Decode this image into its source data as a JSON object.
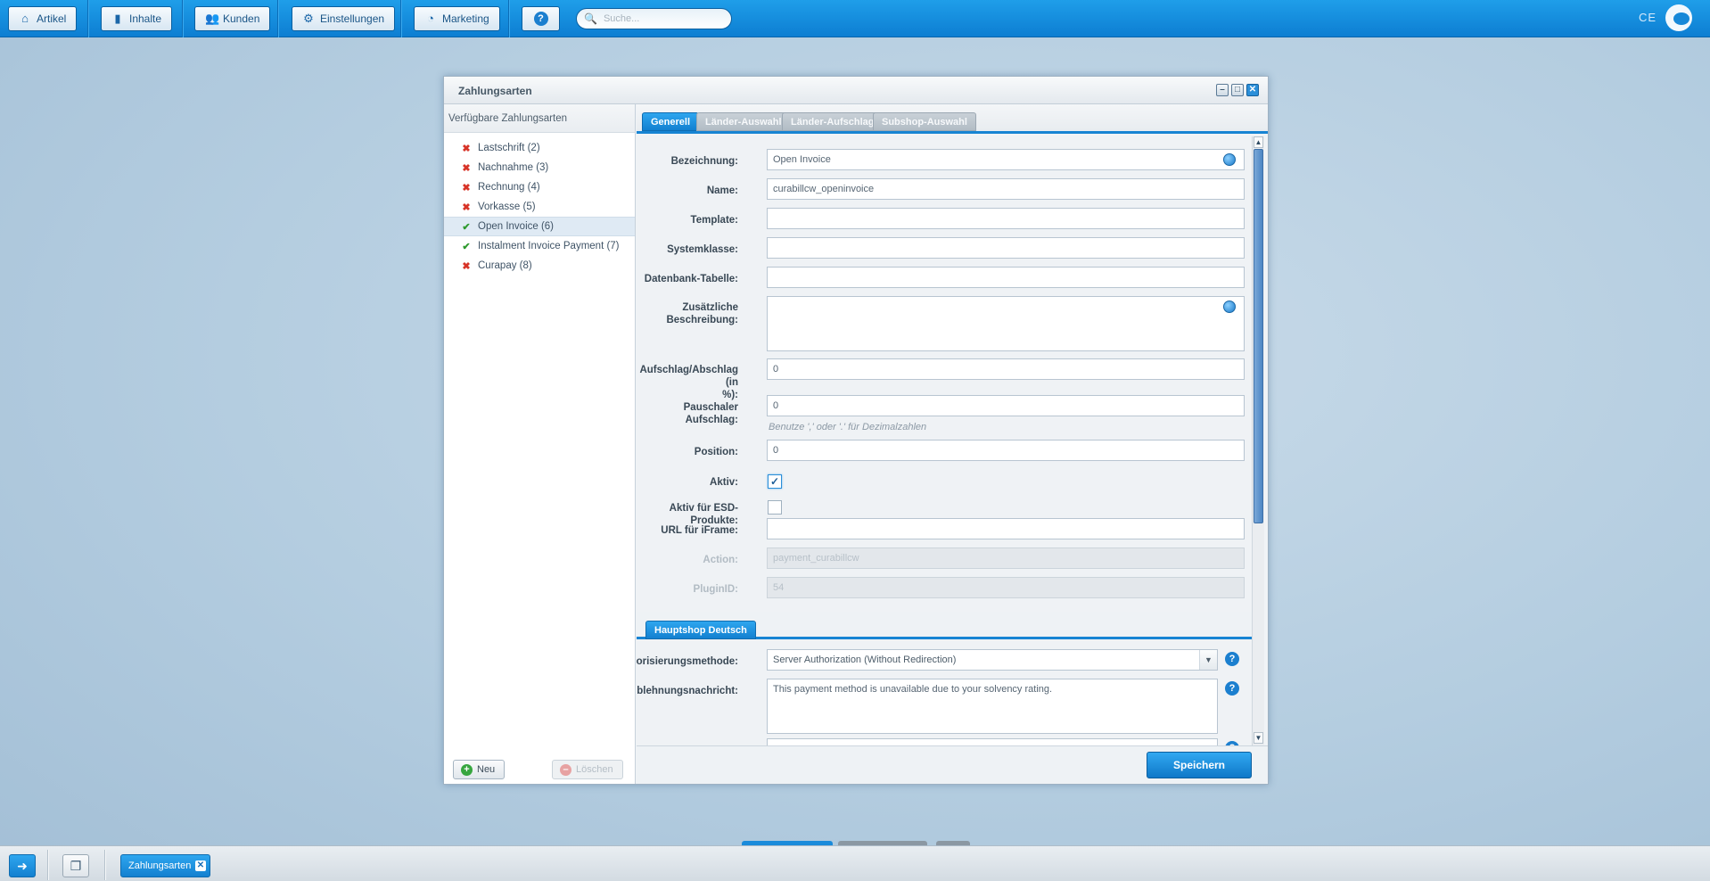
{
  "topbar": {
    "buttons": [
      {
        "label": "Artikel",
        "icon": "article-icon"
      },
      {
        "label": "Inhalte",
        "icon": "content-icon"
      },
      {
        "label": "Kunden",
        "icon": "customers-icon"
      },
      {
        "label": "Einstellungen",
        "icon": "gear-icon"
      },
      {
        "label": "Marketing",
        "icon": "chart-icon"
      }
    ],
    "help_label": "?",
    "search_placeholder": "Suche...",
    "right_text": "CE"
  },
  "window": {
    "title": "Zahlungsarten",
    "left_panel": {
      "header": "Verfügbare Zahlungsarten",
      "items": [
        {
          "label": "Lastschrift (2)",
          "active": false,
          "selected": false
        },
        {
          "label": "Nachnahme (3)",
          "active": false,
          "selected": false
        },
        {
          "label": "Rechnung (4)",
          "active": false,
          "selected": false
        },
        {
          "label": "Vorkasse (5)",
          "active": false,
          "selected": false
        },
        {
          "label": "Open Invoice (6)",
          "active": true,
          "selected": true
        },
        {
          "label": "Instalment Invoice Payment (7)",
          "active": true,
          "selected": false
        },
        {
          "label": "Curapay (8)",
          "active": false,
          "selected": false
        }
      ],
      "new_button": "Neu",
      "delete_button": "Löschen"
    },
    "tabs": [
      "Generell",
      "Länder-Auswahl",
      "Länder-Aufschlag",
      "Subshop-Auswahl"
    ],
    "active_tab": "Generell",
    "form": {
      "bezeichnung": {
        "label": "Bezeichnung:",
        "value": "Open Invoice"
      },
      "name": {
        "label": "Name:",
        "value": "curabillcw_openinvoice"
      },
      "template": {
        "label": "Template:",
        "value": ""
      },
      "systemklasse": {
        "label": "Systemklasse:",
        "value": ""
      },
      "datenbank": {
        "label": "Datenbank-Tabelle:",
        "value": ""
      },
      "beschreibung": {
        "label_line1": "Zusätzliche",
        "label_line2": "Beschreibung:",
        "value": ""
      },
      "aufschlag": {
        "label_line1": "Aufschlag/Abschlag (in",
        "label_line2": "%):",
        "value": "0"
      },
      "pauschal": {
        "label": "Pauschaler Aufschlag:",
        "value": "0",
        "hint": "Benutze ',' oder '.' für Dezimalzahlen"
      },
      "position": {
        "label": "Position:",
        "value": "0"
      },
      "aktiv": {
        "label": "Aktiv:",
        "checked": true,
        "mark": "✓"
      },
      "aktiv_esd": {
        "label": "Aktiv für ESD-Produkte:",
        "checked": false
      },
      "url_iframe": {
        "label": "URL für iFrame:",
        "value": ""
      },
      "action": {
        "label": "Action:",
        "value": "payment_curabillcw"
      },
      "plugin_id": {
        "label": "PluginID:",
        "value": "54"
      }
    },
    "subtab": "Hauptshop Deutsch",
    "shop_form": {
      "autorisierung": {
        "label": "Autorisierungsmethode:",
        "value": "Server Authorization (Without Redirection)"
      },
      "ablehnung": {
        "label": "Ablehnungsnachricht:",
        "value": "This payment method is unavailable due to your solvency rating."
      }
    },
    "save_button": "Speichern"
  },
  "taskbar": {
    "open_window": "Zahlungsarten"
  },
  "colors": {
    "accent": "#1784d3",
    "topbar": "#1f9ee9",
    "active_check": "#2f9a2f",
    "inactive_cross": "#d73327"
  }
}
